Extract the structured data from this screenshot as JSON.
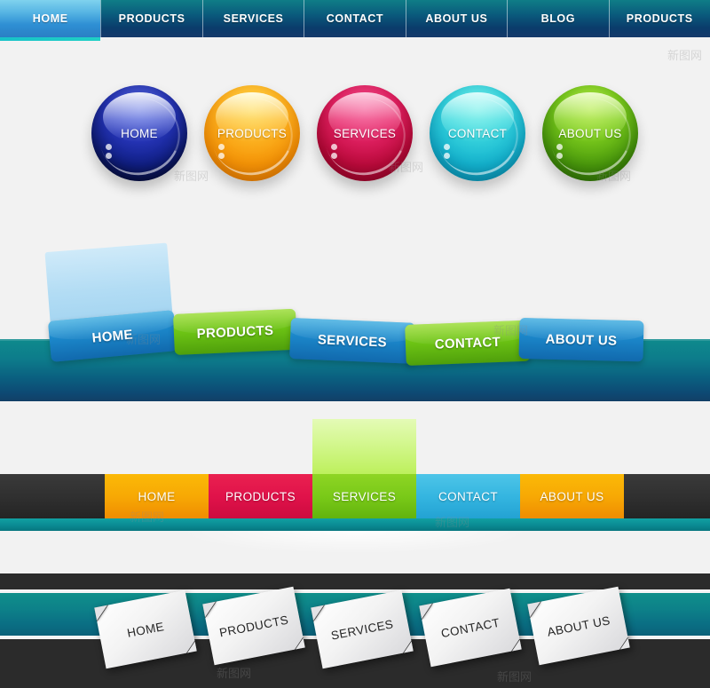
{
  "page": {
    "background_color": "#f2f2f2",
    "watermark_text": "新图网"
  },
  "nav_top": {
    "style_name": "blue-gradient-tab-bar",
    "active_index": 0,
    "active_color": "#58b6e4",
    "base_color": "#0a3c6b",
    "items": [
      {
        "label": "HOME"
      },
      {
        "label": "PRODUCTS"
      },
      {
        "label": "SERVICES"
      },
      {
        "label": "CONTACT"
      },
      {
        "label": "ABOUT US"
      },
      {
        "label": "BLOG"
      },
      {
        "label": "PRODUCTS"
      }
    ]
  },
  "orb_row": {
    "style_name": "glossy-sphere-buttons",
    "items": [
      {
        "label": "HOME",
        "color": "#1b2bac"
      },
      {
        "label": "PRODUCTS",
        "color": "#f7a50c"
      },
      {
        "label": "SERVICES",
        "color": "#d01550"
      },
      {
        "label": "CONTACT",
        "color": "#22c3d5"
      },
      {
        "label": "ABOUT US",
        "color": "#63b414"
      }
    ]
  },
  "nav_tilted": {
    "style_name": "tilted-glossy-tabs-on-teal-bar",
    "bar_color": "#0a6080",
    "dropdown_panel_color": "#b2dcf4",
    "dropdown_on": "HOME",
    "items": [
      {
        "label": "HOME",
        "color": "#1b86c9"
      },
      {
        "label": "PRODUCTS",
        "color": "#6cc314"
      },
      {
        "label": "SERVICES",
        "color": "#1b86c9"
      },
      {
        "label": "CONTACT",
        "color": "#6cc314"
      },
      {
        "label": "ABOUT US",
        "color": "#1b86c9"
      }
    ]
  },
  "nav_dark": {
    "style_name": "dark-bar-colour-blocks",
    "bar_color": "#2f2f2f",
    "strip_color": "#0a8b93",
    "dropdown_panel_color": "#d3f78e",
    "dropdown_on": "SERVICES",
    "items": [
      {
        "label": "HOME",
        "color": "#f7a804"
      },
      {
        "label": "PRODUCTS",
        "color": "#e0124a"
      },
      {
        "label": "SERVICES",
        "color": "#79c918"
      },
      {
        "label": "CONTACT",
        "color": "#34b5e0"
      },
      {
        "label": "ABOUT US",
        "color": "#f7a804"
      }
    ]
  },
  "nav_paper": {
    "style_name": "folded-paper-cards-on-teal-ribbon",
    "background_color": "#2b2b2b",
    "ribbon_color": "#0d8189",
    "card_color": "#f3f3f3",
    "items": [
      {
        "label": "HOME"
      },
      {
        "label": "PRODUCTS"
      },
      {
        "label": "SERVICES"
      },
      {
        "label": "CONTACT"
      },
      {
        "label": "ABOUT US"
      }
    ]
  }
}
